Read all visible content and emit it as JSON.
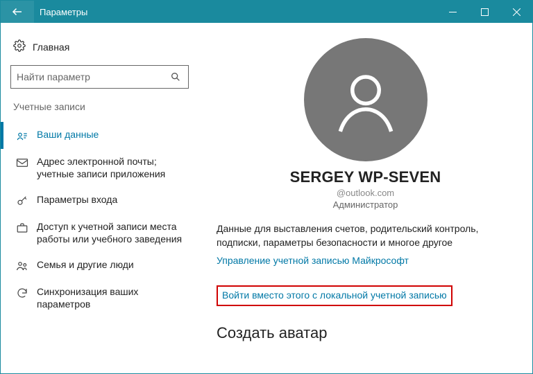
{
  "titlebar": {
    "title": "Параметры"
  },
  "sidebar": {
    "home": "Главная",
    "search_placeholder": "Найти параметр",
    "section": "Учетные записи",
    "items": [
      {
        "label": "Ваши данные"
      },
      {
        "label": "Адрес электронной почты; учетные записи приложения"
      },
      {
        "label": "Параметры входа"
      },
      {
        "label": "Доступ к учетной записи места работы или учебного заведения"
      },
      {
        "label": "Семья и другие люди"
      },
      {
        "label": "Синхронизация ваших параметров"
      }
    ]
  },
  "main": {
    "user_name": "SERGEY WP-SEVEN",
    "user_email": "@outlook.com",
    "user_role": "Администратор",
    "description": "Данные для выставления счетов, родительский контроль, подписки, параметры безопасности и многое другое",
    "manage_link": "Управление учетной записью Майкрософт",
    "local_link": "Войти вместо этого с локальной учетной записью",
    "avatar_heading": "Создать аватар"
  }
}
